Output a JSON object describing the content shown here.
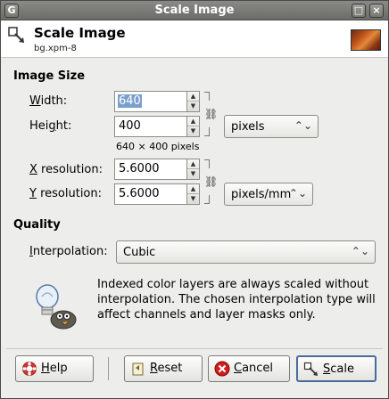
{
  "window": {
    "title": "Scale Image"
  },
  "header": {
    "title": "Scale Image",
    "subtitle": "bg.xpm-8"
  },
  "image_size": {
    "section_label": "Image Size",
    "width_label": "Width:",
    "width_value": "640",
    "height_label": "Height:",
    "height_value": "400",
    "unit": "pixels",
    "size_info": "640 × 400 pixels",
    "xres_label": "X resolution:",
    "xres_value": "5.6000",
    "yres_label": "Y resolution:",
    "yres_value": "5.6000",
    "res_unit": "pixels/mm"
  },
  "quality": {
    "section_label": "Quality",
    "interpolation_label": "Interpolation:",
    "interpolation_value": "Cubic",
    "info_text": "Indexed color layers are always scaled without interpolation. The chosen interpolation type will affect channels and layer masks only."
  },
  "buttons": {
    "help": "Help",
    "reset": "Reset",
    "cancel": "Cancel",
    "scale": "Scale"
  }
}
